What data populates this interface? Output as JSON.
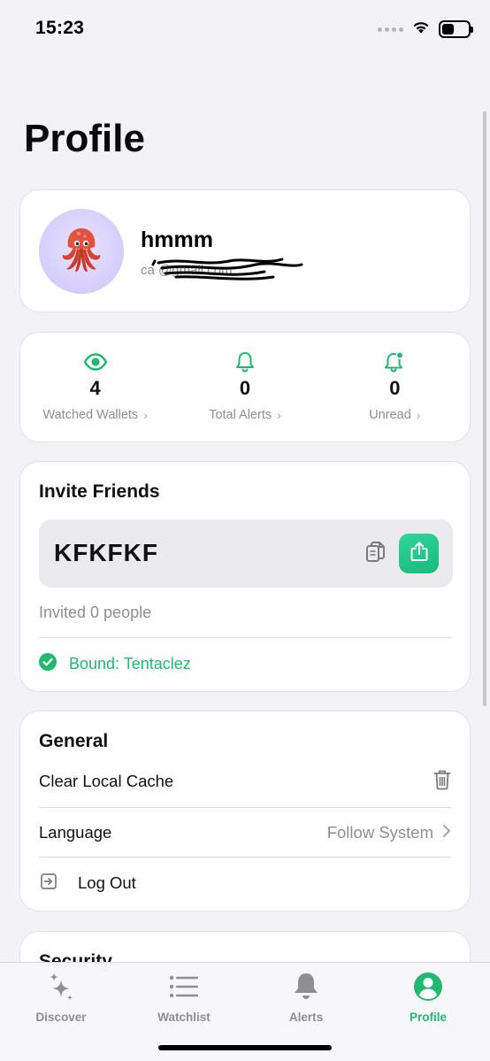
{
  "status_bar": {
    "time": "15:23"
  },
  "page": {
    "title": "Profile"
  },
  "profile": {
    "username": "hmmm",
    "email_visible": "ca                 @gmail.com",
    "avatar_icon": "squid-emoji"
  },
  "stats": [
    {
      "icon": "eye-icon",
      "value": "4",
      "label": "Watched Wallets"
    },
    {
      "icon": "bell-icon",
      "value": "0",
      "label": "Total Alerts"
    },
    {
      "icon": "bell-badge-icon",
      "value": "0",
      "label": "Unread"
    }
  ],
  "invite": {
    "title": "Invite Friends",
    "code": "KFKFKF",
    "invited_text": "Invited 0 people",
    "bound_text": "Bound: Tentaclez"
  },
  "general": {
    "title": "General",
    "clear_cache_label": "Clear Local Cache",
    "language_label": "Language",
    "language_value": "Follow System",
    "logout_label": "Log Out"
  },
  "security": {
    "title": "Security"
  },
  "tabs": [
    {
      "label": "Discover",
      "icon": "sparkles-icon",
      "active": false
    },
    {
      "label": "Watchlist",
      "icon": "list-icon",
      "active": false
    },
    {
      "label": "Alerts",
      "icon": "bell-icon",
      "active": false
    },
    {
      "label": "Profile",
      "icon": "person-circle-icon",
      "active": true
    }
  ],
  "colors": {
    "accent": "#22b872",
    "background": "#f2f2f7",
    "card": "#ffffff",
    "secondary_text": "#8e8e93"
  }
}
